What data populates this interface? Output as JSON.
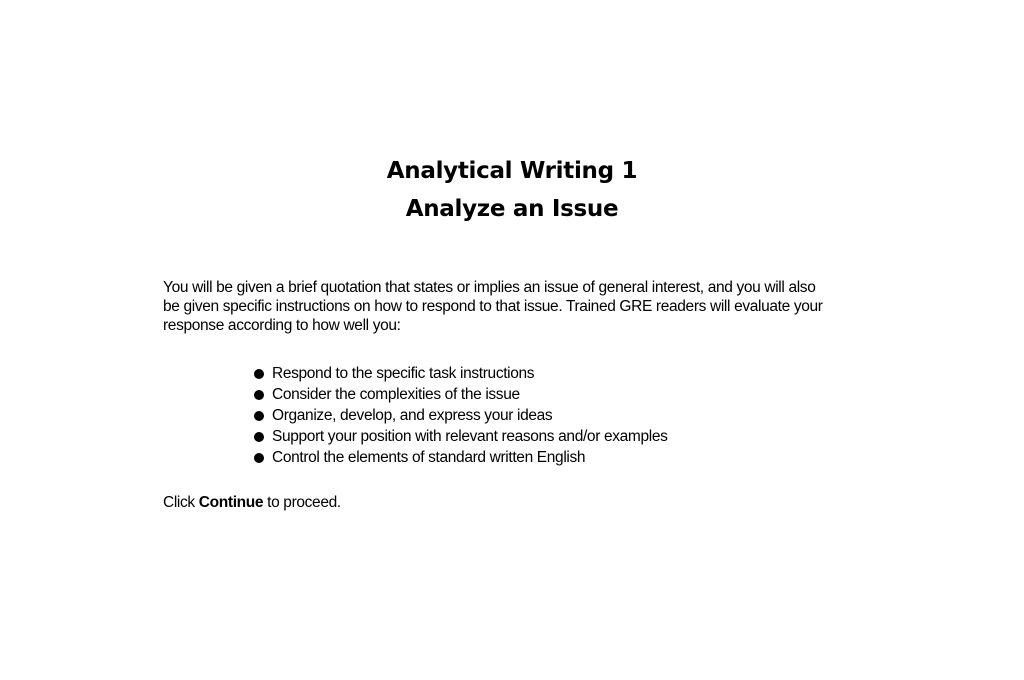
{
  "heading": {
    "title": "Analytical Writing 1",
    "subtitle": "Analyze an Issue"
  },
  "intro_lines": [
    "You will be given a brief quotation that states or implies an issue of general interest, and you will also",
    "be given specific instructions on how to respond to that issue. Trained GRE readers will evaluate your",
    "response according to how well you:"
  ],
  "criteria": [
    "Respond to the specific task instructions",
    "Consider the complexities of the issue",
    "Organize, develop, and express your ideas",
    "Support your position with relevant reasons and/or examples",
    "Control the elements of standard written English"
  ],
  "continue_note": {
    "before": "Click ",
    "bold": "Continue",
    "after": " to proceed."
  }
}
